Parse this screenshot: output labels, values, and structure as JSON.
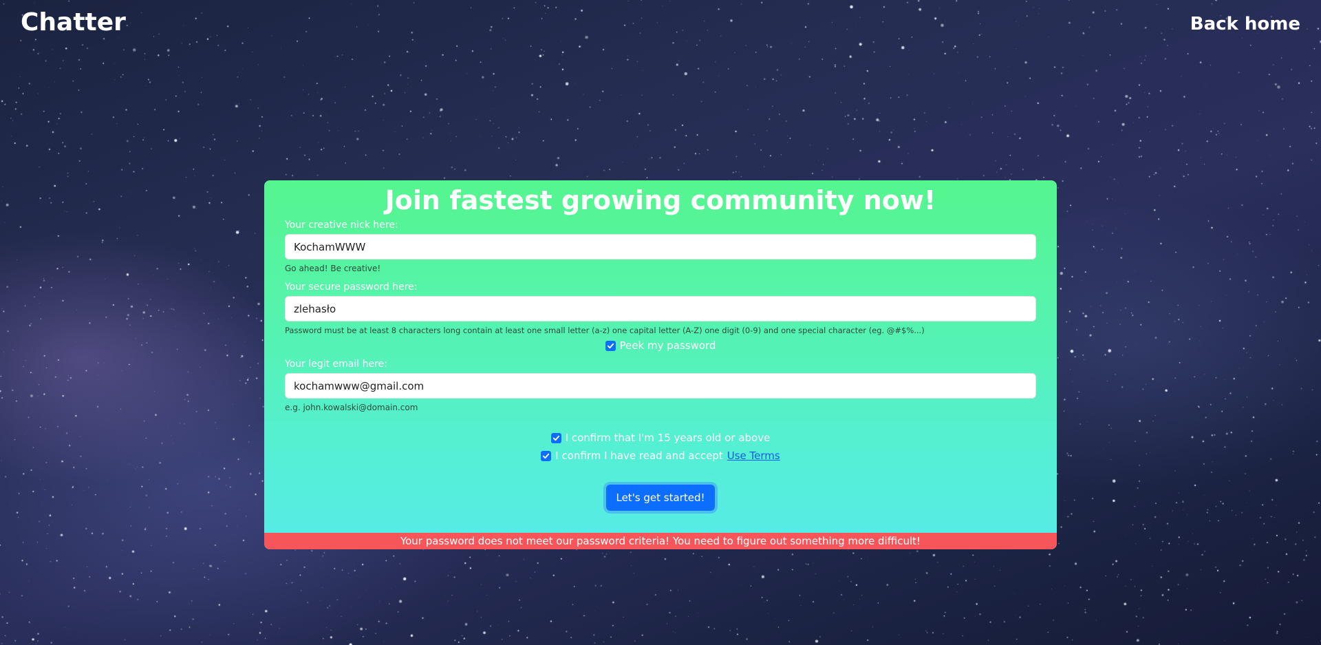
{
  "nav": {
    "brand": "Chatter",
    "back_home": "Back home"
  },
  "form": {
    "title": "Join fastest growing community now!",
    "nick": {
      "label": "Your creative nick here:",
      "value": "KochamWWW",
      "hint": "Go ahead! Be creative!"
    },
    "password": {
      "label": "Your secure password here:",
      "value": "zlehasło",
      "hint": "Password must be at least 8 characters long contain at least one small letter (a-z) one capital letter (A-Z) one digit (0-9) and one special character (eg. @#$%...)",
      "peek_label": "Peek my password",
      "peek_checked": true
    },
    "email": {
      "label": "Your legit email here:",
      "value": "kochamwww@gmail.com",
      "hint": "e.g. john.kowalski@domain.com"
    },
    "age_confirm": {
      "label": "I confirm that I'm 15 years old or above",
      "checked": true
    },
    "terms_confirm": {
      "label": "I confirm I have read and accept",
      "link_text": "Use Terms",
      "checked": true
    },
    "submit_label": "Let's get started!",
    "error_message": "Your password does not meet our password criteria! You need to figure out something more difficult!"
  },
  "colors": {
    "accent": "#0d6efd",
    "card_top": "#55f58f",
    "card_bottom": "#56ebe8",
    "error": "#f6565a"
  }
}
